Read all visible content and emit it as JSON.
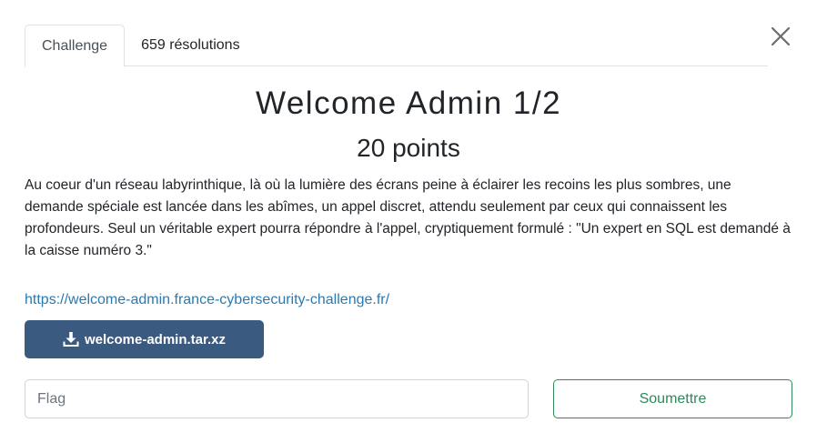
{
  "tabs": [
    {
      "label": "Challenge",
      "active": true
    },
    {
      "label": "659 résolutions",
      "active": false
    }
  ],
  "close": {
    "icon": "close-icon"
  },
  "challenge": {
    "title": "Welcome Admin 1/2",
    "points": "20 points",
    "description": "Au coeur d'un réseau labyrinthique, là où la lumière des écrans peine à éclairer les recoins les plus sombres, une demande spéciale est lancée dans les abîmes, un appel discret, attendu seulement par ceux qui connaissent les profondeurs. Seul un véritable expert pourra répondre à l'appel, cryptiquement formulé : \"Un expert en SQL est demandé à la caisse numéro 3.\"",
    "link": "https://welcome-admin.france-cybersecurity-challenge.fr/",
    "download": {
      "label": "welcome-admin.tar.xz",
      "icon": "download-icon"
    }
  },
  "flag": {
    "placeholder": "Flag",
    "value": ""
  },
  "submit": {
    "label": "Soumettre"
  },
  "colors": {
    "download_bg": "#3b5a7f",
    "submit_accent": "#2e8a5a",
    "link": "#2a7ab0"
  }
}
